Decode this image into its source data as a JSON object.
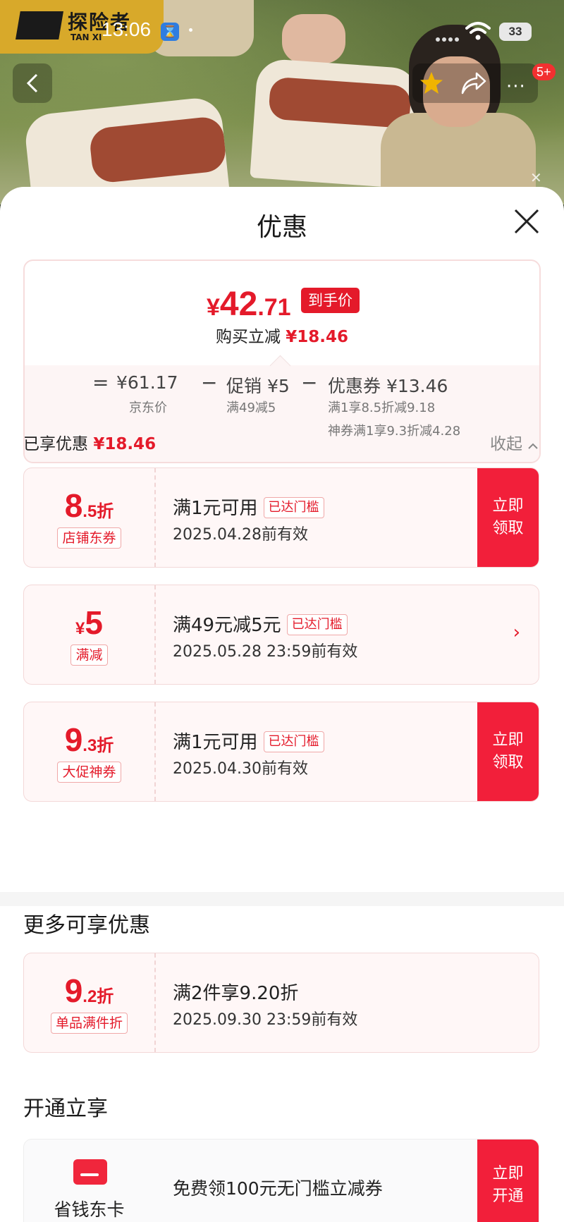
{
  "status": {
    "time": "13:06",
    "battery": "33"
  },
  "brand": {
    "logo_text": "探险者",
    "logo_sub": "TAN XI"
  },
  "header": {
    "badge": "5+"
  },
  "sheet": {
    "title": "优惠"
  },
  "summary": {
    "final_price": {
      "yen": "¥",
      "int": "42",
      "dec": ".71"
    },
    "price_tag": "到手价",
    "save_label": "购买立减",
    "save_amount": "¥18.46",
    "eq": "=",
    "jd_price": "¥61.17",
    "jd_price_label": "京东价",
    "minus1": "−",
    "promo": "促销 ¥5",
    "promo_sub": "满49减5",
    "minus2": "−",
    "coupon": "优惠券 ¥13.46",
    "coupon_sub1": "满1享8.5折减9.18",
    "coupon_sub2": "神券满1享9.3折减4.28"
  },
  "enjoyed": {
    "label": "已享优惠",
    "amount": "¥18.46",
    "collapse": "收起"
  },
  "coupons": [
    {
      "big": "8",
      "small": ".5折",
      "type": "店铺东券",
      "cond": "满1元可用",
      "tag": "已达门槛",
      "valid": "2025.04.28前有效",
      "action": "立即领取"
    },
    {
      "yen": "¥",
      "big": "5",
      "type": "满减",
      "cond": "满49元减5元",
      "tag": "已达门槛",
      "valid": "2025.05.28 23:59前有效",
      "arrow": "›"
    },
    {
      "big": "9",
      "small": ".3折",
      "type": "大促神券",
      "cond": "满1元可用",
      "tag": "已达门槛",
      "valid": "2025.04.30前有效",
      "action": "立即领取"
    }
  ],
  "more": {
    "title": "更多可享优惠",
    "item": {
      "big": "9",
      "small": ".2折",
      "type": "单品满件折",
      "cond": "满2件享9.20折",
      "valid": "2025.09.30 23:59前有效"
    }
  },
  "open": {
    "title": "开通立享",
    "card_name": "省钱东卡",
    "desc": "免费领100元无门槛立减券",
    "action": "立即开通"
  },
  "colors": {
    "accent": "#e41a2a",
    "button": "#f21f3a"
  }
}
